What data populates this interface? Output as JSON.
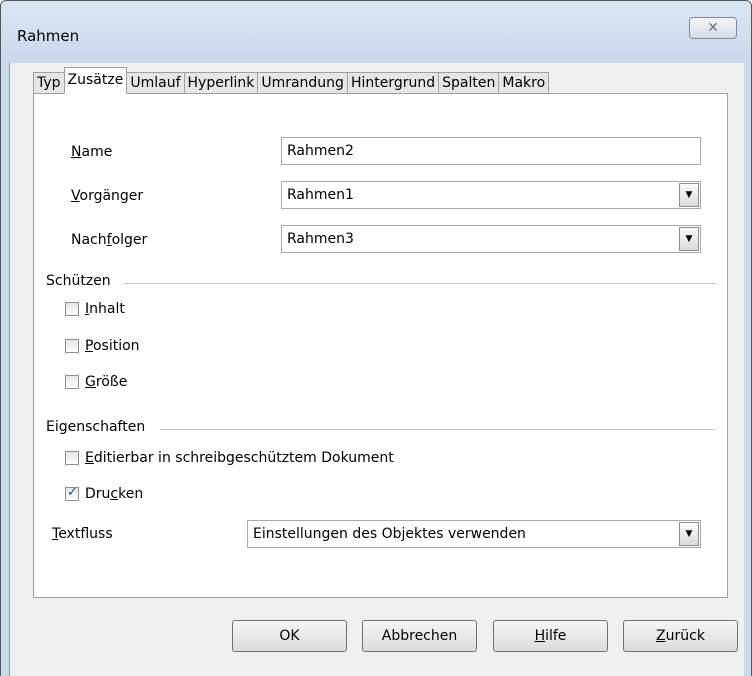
{
  "window": {
    "title": "Rahmen",
    "close_glyph": "✕"
  },
  "tabs": [
    {
      "label": "Typ"
    },
    {
      "label": "Zusätze",
      "active": true
    },
    {
      "label": "Umlauf"
    },
    {
      "label": "Hyperlink"
    },
    {
      "label": "Umrandung"
    },
    {
      "label": "Hintergrund"
    },
    {
      "label": "Spalten"
    },
    {
      "label": "Makro"
    }
  ],
  "fields": {
    "name": {
      "label_pre": "",
      "label_u": "N",
      "label_post": "ame",
      "value": "Rahmen2"
    },
    "vorgaenger": {
      "label_pre": "",
      "label_u": "V",
      "label_post": "orgänger",
      "value": "Rahmen1"
    },
    "nachfolger": {
      "label_pre": "Nach",
      "label_u": "f",
      "label_post": "olger",
      "value": "Rahmen3"
    }
  },
  "schuetzen": {
    "title": "Schützen",
    "items": [
      {
        "label_pre": "",
        "label_u": "I",
        "label_post": "nhalt",
        "checked": false
      },
      {
        "label_pre": "",
        "label_u": "P",
        "label_post": "osition",
        "checked": false
      },
      {
        "label_pre": "",
        "label_u": "G",
        "label_post": "röße",
        "checked": false
      }
    ]
  },
  "eigenschaften": {
    "title": "Eigenschaften",
    "editierbar": {
      "label_pre": "",
      "label_u": "E",
      "label_post": "ditierbar in schreibgeschütztem Dokument",
      "checked": false
    },
    "drucken": {
      "label_pre": "Dru",
      "label_u": "c",
      "label_post": "ken",
      "checked": true
    },
    "textfluss": {
      "label_pre": "",
      "label_u": "T",
      "label_post": "extfluss",
      "value": "Einstellungen des Objektes verwenden"
    }
  },
  "buttons": {
    "ok": {
      "label_pre": "OK",
      "label_u": "",
      "label_post": ""
    },
    "abbrechen": {
      "label_pre": "Abbrechen",
      "label_u": "",
      "label_post": ""
    },
    "hilfe": {
      "label_pre": "",
      "label_u": "H",
      "label_post": "ilfe"
    },
    "zurueck": {
      "label_pre": "",
      "label_u": "Z",
      "label_post": "urück"
    }
  },
  "icons": {
    "dropdown_arrow": "▼"
  }
}
